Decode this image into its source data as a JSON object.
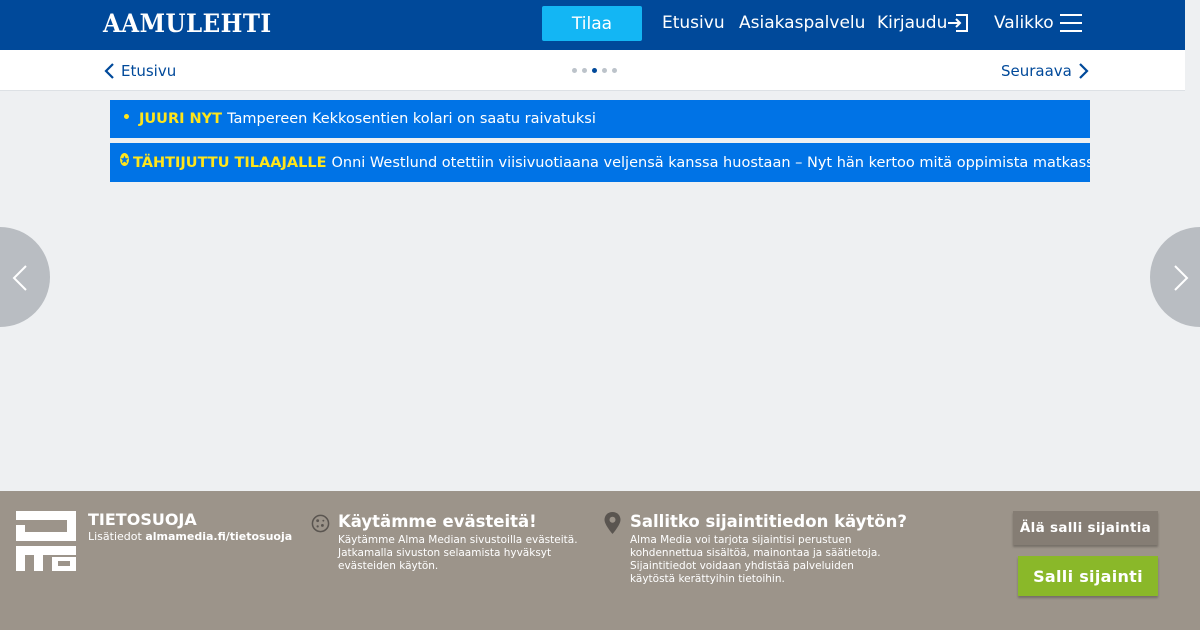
{
  "header": {
    "logo": "AAMULEHTI",
    "subscribe_label": "Tilaa",
    "nav": {
      "etusivu": "Etusivu",
      "asiakaspalvelu": "Asiakaspalvelu",
      "kirjaudu": "Kirjaudu",
      "valikko": "Valikko"
    },
    "icons": {
      "login": "login-arrow-icon",
      "menu": "hamburger-menu-icon"
    },
    "colors": {
      "bar": "#00499a",
      "subscribe": "#13b6f4"
    }
  },
  "subnav": {
    "back_label": "Etusivu",
    "next_label": "Seuraava",
    "pager": {
      "total": 5,
      "active_index": 2
    }
  },
  "news": [
    {
      "tag": "JUURI NYT",
      "text": "Tampereen Kekkosentien kolari on saatu raivatuksi"
    },
    {
      "tag": "TÄHTIJUTTU TILAAJALLE",
      "text": "Onni Westlund otettiin viisivuotiaana veljensä kanssa huostaan – Nyt hän kertoo mitä oppimista matkassa oli"
    }
  ],
  "consent": {
    "privacy": {
      "title": "TIETOSUOJA",
      "info_prefix": "Lisätiedot",
      "info_link": "almamedia.fi/tietosuoja"
    },
    "cookies": {
      "title": "Käytämme evästeitä!",
      "text": "Käytämme Alma Median sivustoilla evästeitä. Jatkamalla sivuston selaamista hyväksyt evästeiden käytön."
    },
    "location": {
      "title": "Sallitko sijaintitiedon käytön?",
      "text": "Alma Media voi tarjota sijaintisi perustuen kohdennettua sisältöä, mainontaa ja säätietoja. Sijaintitiedot voidaan yhdistää palveluiden käytöstä kerättyihin tietoihin."
    },
    "deny_label": "Älä salli sijaintia",
    "allow_label": "Salli sijainti",
    "colors": {
      "background": "#9c948a",
      "allow": "#8ab829",
      "deny": "#857d74"
    }
  }
}
